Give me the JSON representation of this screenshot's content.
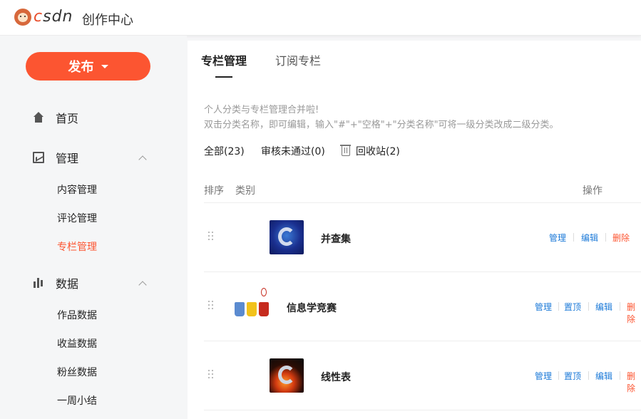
{
  "header": {
    "logo_text": "CSDN",
    "title": "创作中心"
  },
  "sidebar": {
    "publish_label": "发布",
    "nav": [
      {
        "label": "首页",
        "icon": "home-icon"
      },
      {
        "label": "管理",
        "icon": "chart-trend-icon",
        "expanded": true
      },
      {
        "label": "数据",
        "icon": "bar-chart-icon",
        "expanded": true
      }
    ],
    "manage_sub": [
      "内容管理",
      "评论管理",
      "专栏管理"
    ],
    "data_sub": [
      "作品数据",
      "收益数据",
      "粉丝数据",
      "一周小结"
    ],
    "active_sub": "专栏管理"
  },
  "tabs": [
    "专栏管理",
    "订阅专栏"
  ],
  "notice": {
    "line1": "个人分类与专栏管理合并啦!",
    "line2": "双击分类名称，即可编辑，输入\"#\"+\"空格\"+\"分类名称\"可将一级分类改成二级分类。"
  },
  "filters": {
    "all": "全部(23)",
    "pending": "审核未通过(0)",
    "recycle": "回收站(2)"
  },
  "table": {
    "headers": {
      "order": "排序",
      "category": "类别",
      "actions": "操作"
    },
    "rows": [
      {
        "name": "并查集",
        "actions": [
          "管理",
          "编辑",
          "删除"
        ]
      },
      {
        "name": "信息学竞赛",
        "actions": [
          "管理",
          "置顶",
          "编辑",
          "删除"
        ]
      },
      {
        "name": "线性表",
        "actions": [
          "管理",
          "置顶",
          "编辑",
          "删除"
        ]
      }
    ]
  },
  "colors": {
    "accent": "#fc5531",
    "link": "#1c7ad8"
  }
}
